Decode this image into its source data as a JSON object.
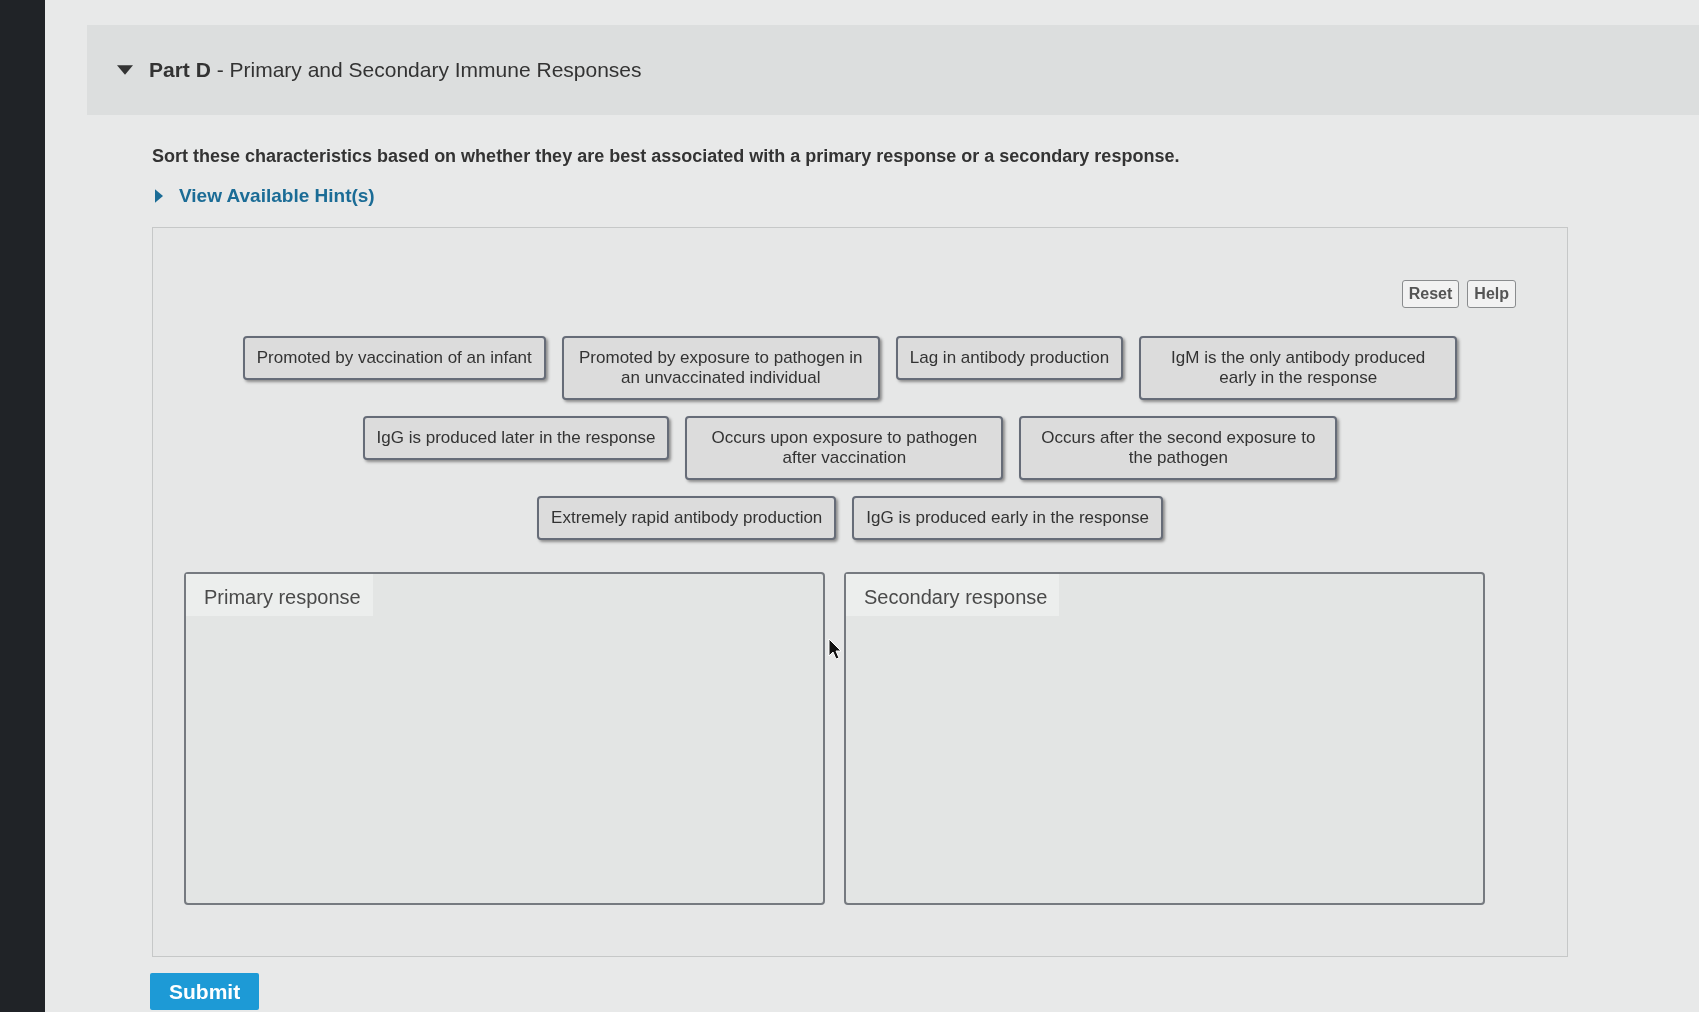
{
  "part": {
    "title": "**Part D** - Primary and Secondary Immune Responses",
    "expanded": true
  },
  "instruction": "Sort these characteristics based on whether they are best associated with a primary response or a secondary response.",
  "hints": {
    "label": "View Available Hint(s)",
    "expanded": false
  },
  "toolbar_buttons": [
    "Reset",
    "Help"
  ],
  "items": [
    "Promoted by vaccination of an infant",
    "Promoted by exposure to pathogen in an unvaccinated individual",
    "Lag in antibody production",
    "IgM is the only antibody produced early in the response",
    "IgG is produced later in the response",
    "Occurs upon exposure to pathogen after vaccination",
    "Occurs after the second exposure to the pathogen",
    "Extremely rapid antibody production",
    "IgG is produced early in the response"
  ],
  "bins": [
    {
      "label": "Primary response"
    },
    {
      "label": "Secondary response"
    }
  ],
  "submit": "Submit"
}
